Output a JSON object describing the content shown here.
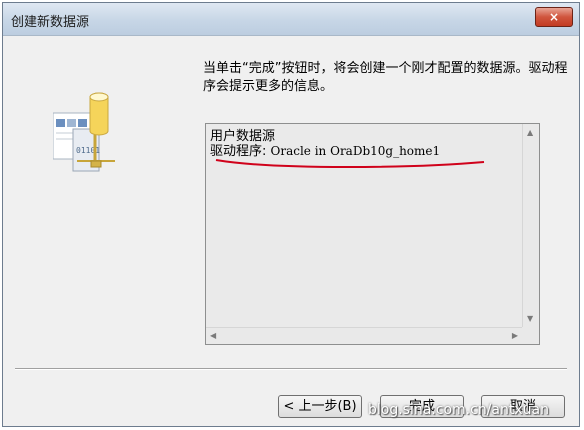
{
  "window": {
    "title": "创建新数据源",
    "close_label": "×"
  },
  "message": "当单击“完成”按钮时，将会创建一个刚才配置的数据源。驱动程序会提示更多的信息。",
  "details": {
    "line1": "用户数据源",
    "driver_label": "驱动程序: ",
    "driver_value": "Oracle in OraDb10g_home1",
    "illustration_code": "01101"
  },
  "buttons": {
    "back": "< 上一步(B)",
    "finish": "完成",
    "cancel": "取消"
  },
  "watermark": "blog.sina.com.cn/antxuan",
  "colors": {
    "annotation": "#d0021b",
    "close_button": "#c9452c"
  }
}
